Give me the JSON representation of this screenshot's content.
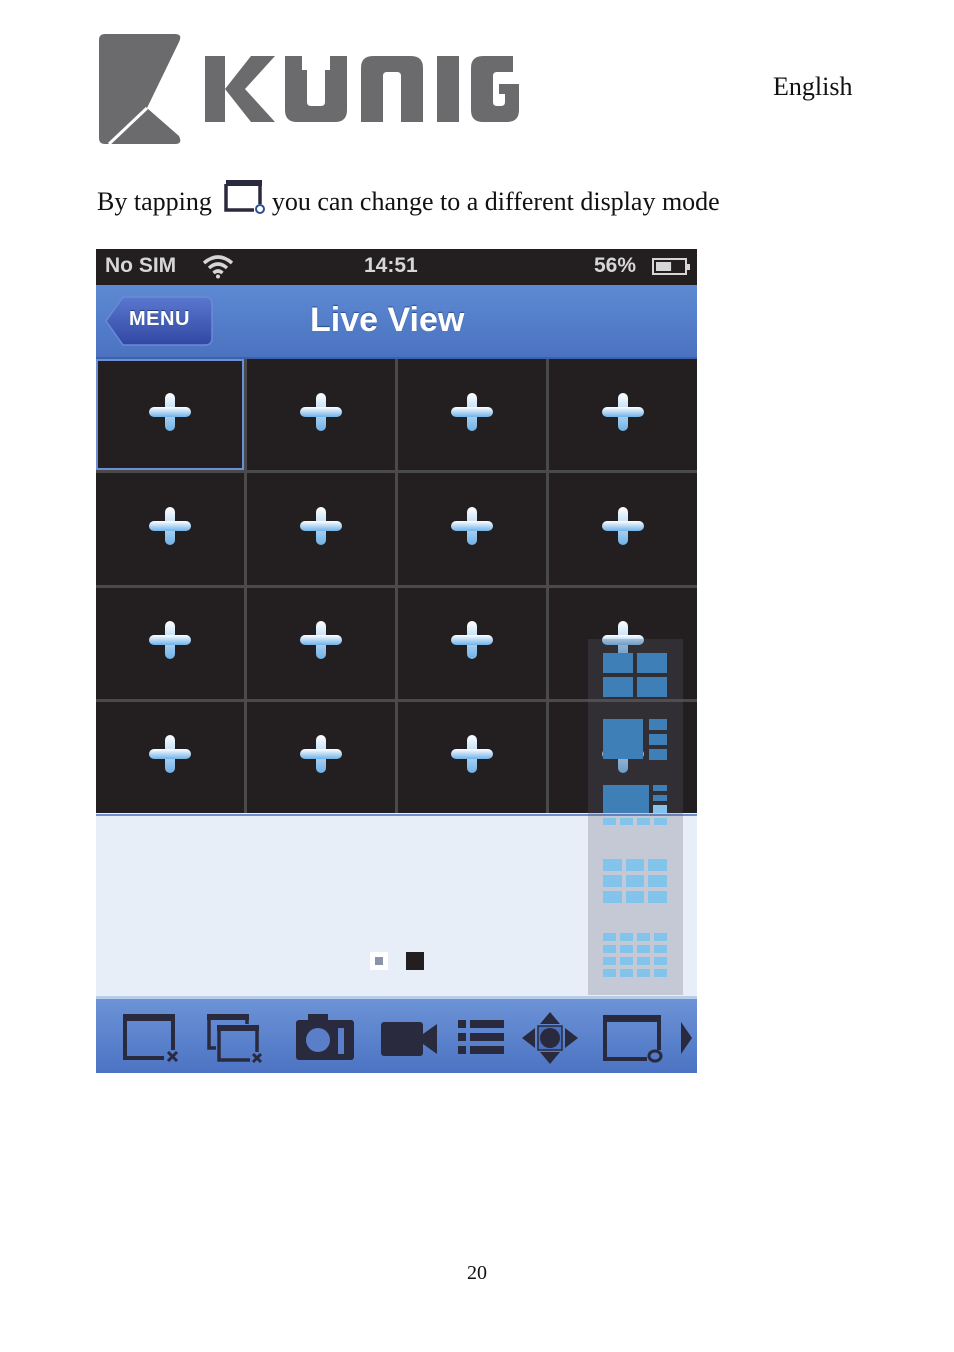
{
  "document": {
    "brand": "KÖNIG",
    "language": "English",
    "intro_before": "By tapping",
    "intro_after": "you can change to a different display mode",
    "intro_icon": "display-mode-icon",
    "page_number": "20"
  },
  "statusbar": {
    "carrier": "No SIM",
    "wifi_icon": "wifi-icon",
    "time": "14:51",
    "battery_percent": "56%",
    "battery_level": 0.56
  },
  "navbar": {
    "back_button": "MENU",
    "title": "Live View"
  },
  "grid": {
    "rows": 4,
    "columns": 4,
    "selected_cell": 1,
    "cell_icon": "add-channel-icon",
    "cells": [
      {
        "row": 1,
        "col": 1
      },
      {
        "row": 1,
        "col": 2
      },
      {
        "row": 1,
        "col": 3
      },
      {
        "row": 1,
        "col": 4
      },
      {
        "row": 2,
        "col": 1
      },
      {
        "row": 2,
        "col": 2
      },
      {
        "row": 2,
        "col": 3
      },
      {
        "row": 2,
        "col": 4
      },
      {
        "row": 3,
        "col": 1
      },
      {
        "row": 3,
        "col": 2
      },
      {
        "row": 3,
        "col": 3
      },
      {
        "row": 3,
        "col": 4
      },
      {
        "row": 4,
        "col": 1
      },
      {
        "row": 4,
        "col": 2
      },
      {
        "row": 4,
        "col": 3
      },
      {
        "row": 4,
        "col": 4
      }
    ]
  },
  "pagination": {
    "pages": 2,
    "current_page": 2
  },
  "display_modes": [
    {
      "name": "layout-4-grid-icon",
      "label": "2x2"
    },
    {
      "name": "layout-1-plus-3-icon",
      "label": "1+3"
    },
    {
      "name": "layout-1-plus-7-icon",
      "label": "1+7"
    },
    {
      "name": "layout-9-grid-icon",
      "label": "3x3"
    },
    {
      "name": "layout-16-grid-icon",
      "label": "4x4"
    }
  ],
  "toolbar": [
    {
      "name": "close-window-icon",
      "action": "Close channel"
    },
    {
      "name": "close-all-windows-icon",
      "action": "Close all channels"
    },
    {
      "name": "camera-snapshot-icon",
      "action": "Snapshot"
    },
    {
      "name": "video-record-icon",
      "action": "Record"
    },
    {
      "name": "list-icon",
      "action": "Device list"
    },
    {
      "name": "ptz-control-icon",
      "action": "PTZ"
    },
    {
      "name": "display-mode-icon",
      "action": "Display mode"
    },
    {
      "name": "chevron-right-icon",
      "action": "More"
    }
  ],
  "colors": {
    "navbar_blue": "#5478c8",
    "statusbar_bg": "#231f20",
    "cell_bg": "#231f20",
    "grid_line": "#4a4a4a",
    "selected_outline": "#6d8fd4",
    "lower_bg": "#e8eef7",
    "icon_dark": "#2a2a3e",
    "mode_icon_blue": "#3e7fb8",
    "mode_icon_light": "#82c4ec",
    "logo_gray": "#6b6b6e"
  }
}
